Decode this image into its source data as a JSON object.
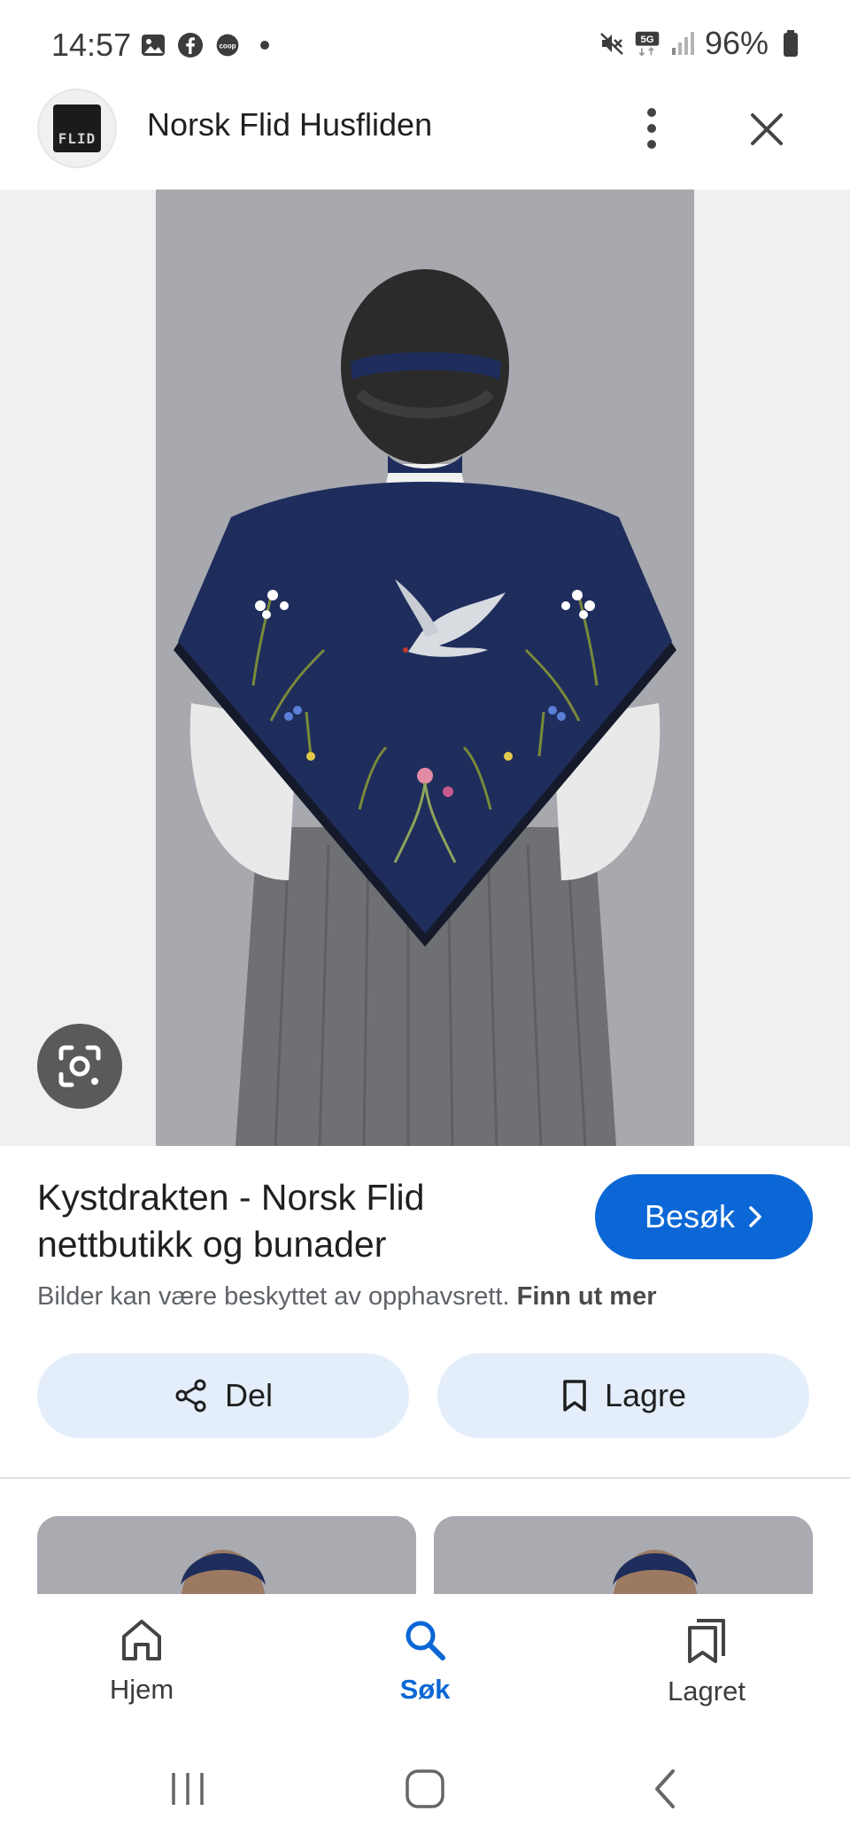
{
  "status_bar": {
    "time": "14:57",
    "left_icons": [
      "gallery-icon",
      "facebook-icon",
      "coop-icon",
      "notification-dot-icon"
    ],
    "right_icons": [
      "mute-icon",
      "5g-icon",
      "signal-icon",
      "battery-icon"
    ],
    "network": "5G",
    "battery": "96%"
  },
  "header": {
    "site_name": "Norsk Flid Husfliden",
    "logo_text": "FLID"
  },
  "result": {
    "title": "Kystdrakten - Norsk Flid nettbutikk og bunader",
    "visit_label": "Besøk",
    "copyright_text": "Bilder kan være beskyttet av opphavsrett.",
    "learn_more": "Finn ut mer"
  },
  "actions": {
    "share_label": "Del",
    "save_label": "Lagre"
  },
  "bottom_nav": {
    "items": [
      {
        "label": "Hjem",
        "icon": "home-icon",
        "active": false
      },
      {
        "label": "Søk",
        "icon": "search-icon",
        "active": true
      },
      {
        "label": "Lagret",
        "icon": "saved-icon",
        "active": false
      }
    ]
  },
  "colors": {
    "accent": "#0b67d6",
    "chip_bg": "#e4eefb",
    "shawl": "#1e2d5c",
    "photo_bg": "#a7a9ae"
  }
}
